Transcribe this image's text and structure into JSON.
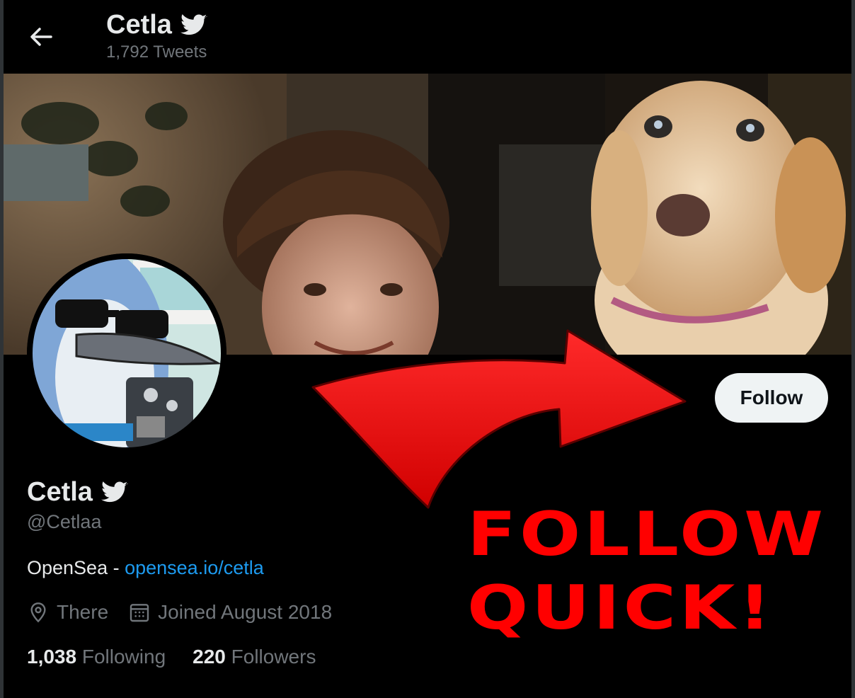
{
  "header": {
    "name": "Cetla",
    "tweets": "1,792 Tweets"
  },
  "profile": {
    "name": "Cetla",
    "handle": "@Cetlaa",
    "bio_text": "OpenSea - ",
    "bio_link": "opensea.io/cetla",
    "location": "There",
    "joined": "Joined August 2018",
    "following_count": "1,038",
    "following_label": "Following",
    "followers_count": "220",
    "followers_label": "Followers"
  },
  "actions": {
    "follow_label": "Follow"
  },
  "overlay": {
    "line1": "FOLLOW",
    "line2": "QUICK!"
  },
  "colors": {
    "background": "#000000",
    "link": "#1d9bf0",
    "muted": "#71767b",
    "overlay_red": "#ff0000",
    "verified": "#e7e9ea"
  },
  "icons": {
    "back": "back-arrow-icon",
    "verified": "verified-bird-icon",
    "location": "location-pin-icon",
    "calendar": "calendar-icon"
  }
}
